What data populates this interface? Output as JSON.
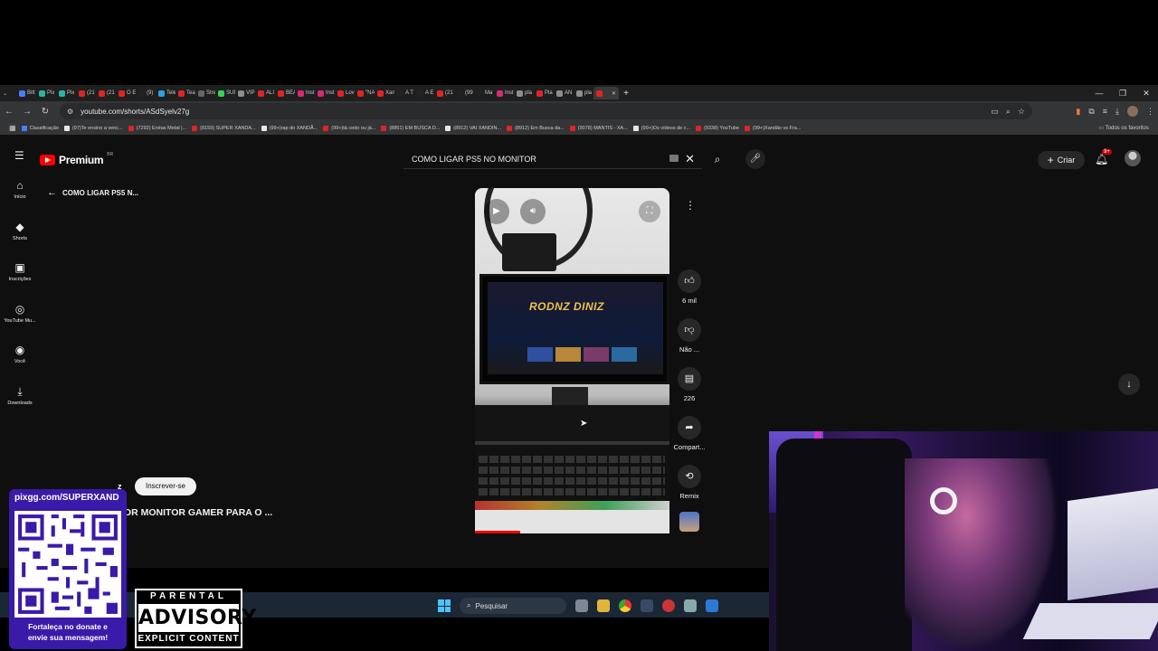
{
  "browser": {
    "tabs": [
      "Bitt",
      "Pix",
      "Pix",
      "(21",
      "(21",
      "O E",
      "(9)",
      "Tele",
      "Tea",
      "Stre",
      "SUF",
      "VIP",
      "ALI",
      "BEA",
      "Inst",
      "Inst",
      "Lov",
      "\"NA",
      "Xan",
      "A T",
      "A E",
      "(21",
      "(99",
      "Ma",
      "Inst",
      "pla",
      "Pla",
      "AN",
      "pla",
      ""
    ],
    "tab_colors": [
      "#4a7cff",
      "#2bb3a3",
      "#2bb3a3",
      "#e02424",
      "#e02424",
      "#e02424",
      "#222222",
      "#2aa3e0",
      "#e02424",
      "#666666",
      "#39d353",
      "#8e8e8e",
      "#e02424",
      "#e02424",
      "#d62976",
      "#d62976",
      "#e02424",
      "#e02424",
      "#e02424",
      "#222222",
      "#222222",
      "#e02424",
      "#222222",
      "#222222",
      "#d62976",
      "#8e8e8e",
      "#e02424",
      "#8e8e8e",
      "#8e8e8e",
      "#e02424"
    ],
    "url": "youtube.com/shorts/ASdSyelv27g",
    "bookmarks": [
      "Classificação",
      "(97)Te ensino a venc...",
      "(7292) Enéas Metal |...",
      "(8159) SUPER XANDA...",
      "(99+)rap do XANDÃ...",
      "(99+)tá cedo ou já...",
      "(8851) EM BUSCA D...",
      "(8912) VAI XANDIN...",
      "(8912) Em Busca da...",
      "(9078) MANTIS - XA...",
      "(99+)Os vídeos de c...",
      "(9338) YouTube",
      "(99+)Xandão vs Fra..."
    ],
    "bookmarks_all": "Todos os favoritos"
  },
  "youtube": {
    "logo_text": "Premium",
    "logo_region": "BR",
    "search_value": "COMO LIGAR PS5 NO MONITOR",
    "create_label": "Criar",
    "notif_badge": "9+",
    "nav": [
      {
        "label": "Início",
        "icon": "home-icon"
      },
      {
        "label": "Shorts",
        "icon": "shorts-icon"
      },
      {
        "label": "Inscrições",
        "icon": "subscriptions-icon"
      },
      {
        "label": "YouTube Mu...",
        "icon": "youtube-music-icon"
      },
      {
        "label": "Você",
        "icon": "you-icon"
      },
      {
        "label": "Downloads",
        "icon": "download-icon"
      }
    ],
    "back_label": "COMO LIGAR PS5 N...",
    "video_screen_text": "RODNZ DINIZ",
    "actions": {
      "likes": "6 mil",
      "dislike": "Não ...",
      "comments": "226",
      "share": "Compart...",
      "remix": "Remix"
    },
    "channel_suffix": "z",
    "subscribe_label": "Inscrever-se",
    "video_title": "IOR MONITOR GAMER PARA O ..."
  },
  "taskbar": {
    "search_placeholder": "Pesquisar"
  },
  "overlay": {
    "qr_header": "pixgg.com/SUPERXAND",
    "qr_footer_line1": "Fortaleça no donate e",
    "qr_footer_line2": "envie sua mensagem!",
    "advisory_top": "PARENTAL",
    "advisory_mid": "ADVISORY",
    "advisory_bottom": "EXPLICIT CONTENT"
  }
}
